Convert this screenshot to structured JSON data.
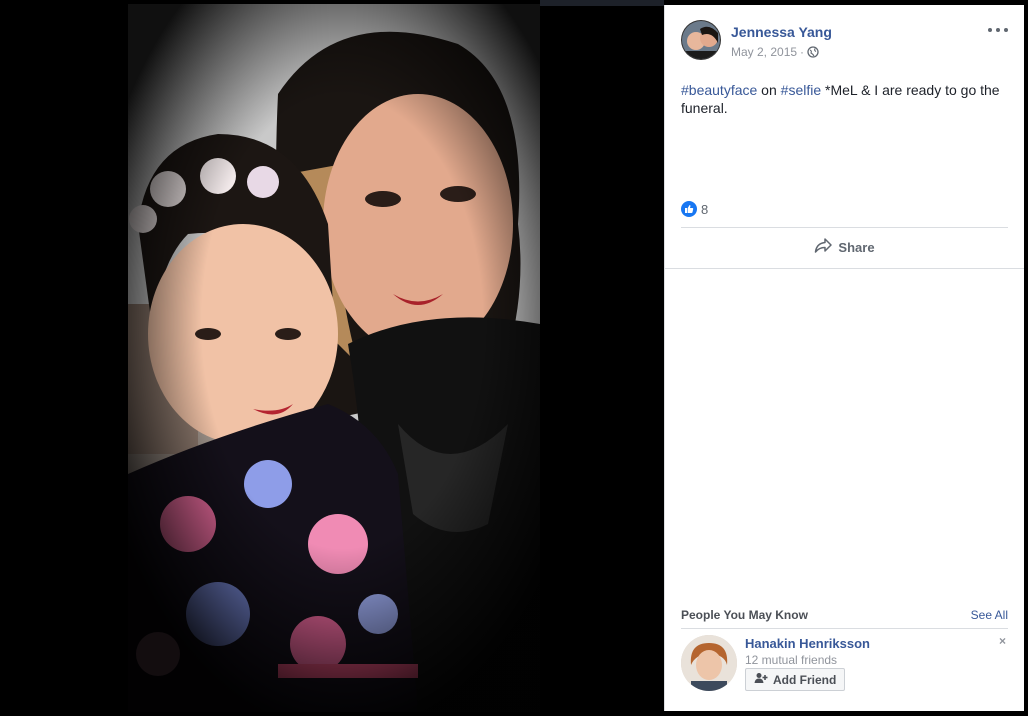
{
  "post": {
    "author": "Jennessa Yang",
    "date": "May 2, 2015",
    "meta_separator": "·",
    "privacy_icon": "globe-icon",
    "text": {
      "hashtag_1": "#beautyface",
      "connector": " on ",
      "hashtag_2": "#selfie",
      "rest": " *MeL & I are ready to go the funeral."
    },
    "reactions": {
      "icon": "like-icon",
      "count": "8"
    },
    "share_label": "Share",
    "more_icon": "more-options-icon"
  },
  "people_you_may_know": {
    "title": "People You May Know",
    "see_all": "See All",
    "suggestion": {
      "name": "Hanakin Henriksson",
      "mutual": "12 mutual friends",
      "add_label": "Add Friend",
      "dismiss": "×"
    }
  },
  "colors": {
    "link": "#385898",
    "like_badge": "#1877f2",
    "background": "#000000"
  }
}
